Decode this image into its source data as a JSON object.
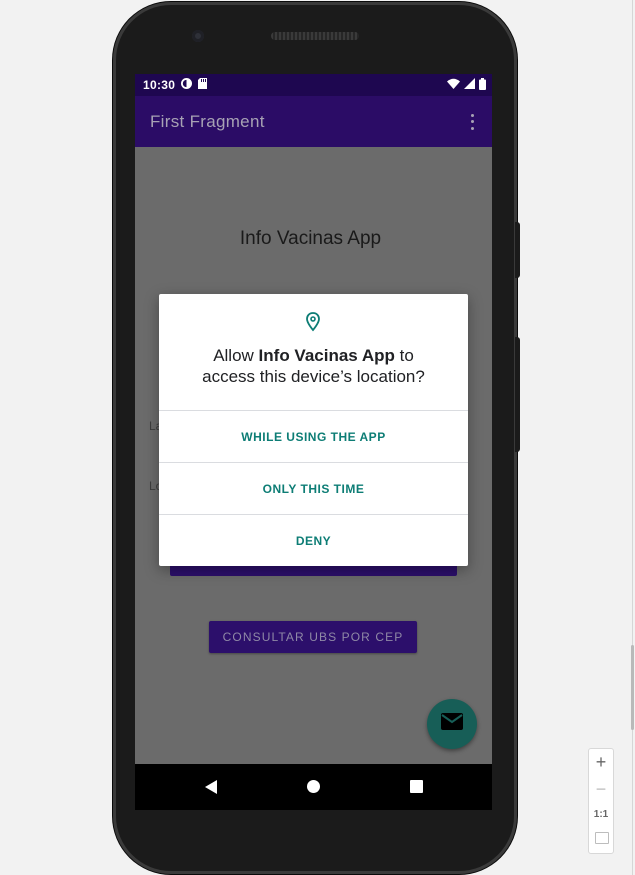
{
  "status_bar": {
    "time": "10:30",
    "icons": [
      "data-saver-icon",
      "sd-card-icon",
      "wifi-icon",
      "signal-icon",
      "battery-icon"
    ]
  },
  "app_bar": {
    "title": "First Fragment",
    "menu_icon": "overflow-menu-icon"
  },
  "fragment": {
    "title": "Info Vacinas App",
    "latitude_label": "La",
    "longitude_label": "Lo",
    "cep_button_label": "CONSULTAR UBS POR CEP",
    "fab_icon": "mail-icon"
  },
  "permission_dialog": {
    "icon": "location-pin-icon",
    "message_prefix": "Allow ",
    "app_name": "Info Vacinas App",
    "message_suffix_1": " to",
    "message_line2": "access this device’s location?",
    "options": [
      {
        "label": "WHILE USING THE APP"
      },
      {
        "label": "ONLY THIS TIME"
      },
      {
        "label": "DENY"
      }
    ]
  },
  "nav_bar": {
    "icons": [
      "back-icon",
      "home-icon",
      "recents-icon"
    ]
  },
  "zoom_controls": {
    "zoom_in": "+",
    "zoom_out": "−",
    "actual_size": "1:1",
    "fit_icon": "fit-screen-icon"
  },
  "colors": {
    "status_bar": "#1e0750",
    "app_bar": "#2b0c66",
    "primary_button": "#2c0f6b",
    "dialog_accent": "#0d7d75",
    "fab": "#175e57",
    "scrim_background": "#6b6b6b"
  }
}
